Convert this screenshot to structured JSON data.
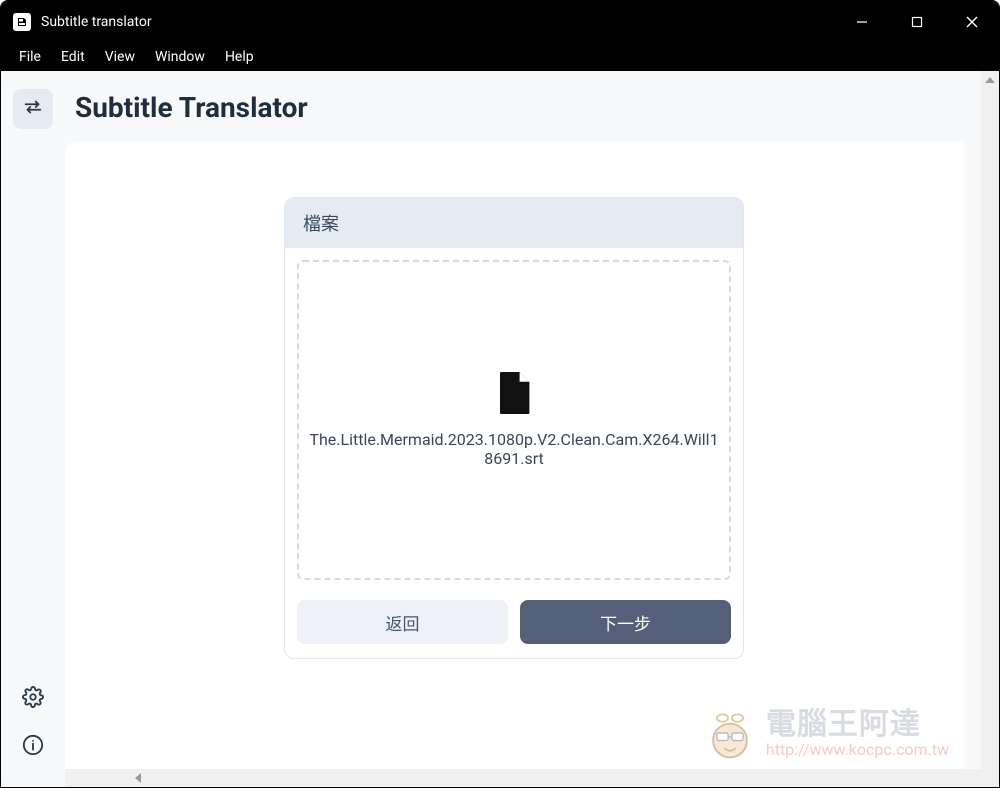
{
  "titlebar": {
    "title": "Subtitle translator"
  },
  "menu": {
    "file": "File",
    "edit": "Edit",
    "view": "View",
    "window": "Window",
    "help": "Help"
  },
  "page": {
    "title": "Subtitle Translator"
  },
  "card": {
    "header": "檔案",
    "filename": "The.Little.Mermaid.2023.1080p.V2.Clean.Cam.X264.Will18691.srt",
    "back_label": "返回",
    "next_label": "下一步"
  },
  "watermark": {
    "title": "電腦王阿達",
    "url": "http://www.kocpc.com.tw"
  }
}
